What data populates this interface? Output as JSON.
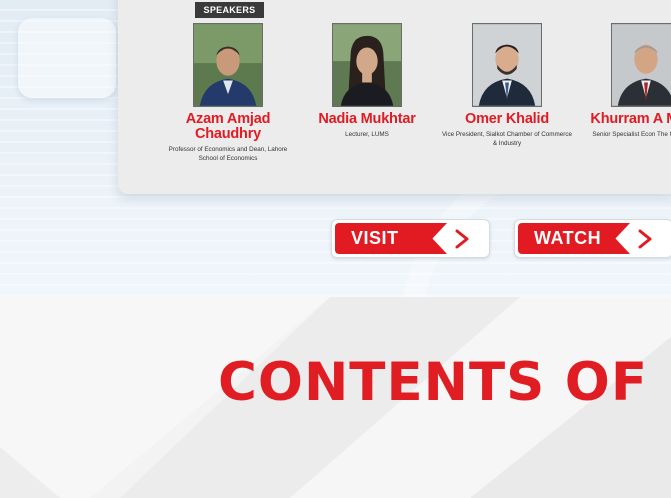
{
  "speakers_label": "SPEAKERS",
  "speakers": [
    {
      "name": "Azam Amjad Chaudhry",
      "title": "Professor of Economics and Dean, Lahore School of Economics"
    },
    {
      "name": "Nadia Mukhtar",
      "title": "Lecturer, LUMS"
    },
    {
      "name": "Omer Khalid",
      "title": "Vice President, Sialkot Chamber of Commerce & Industry"
    },
    {
      "name": "Khurram A Malik",
      "title": "Senior Specialist Econ The Urban Unit"
    }
  ],
  "buttons": {
    "visit_label": "VISIT",
    "watch_label": "WATCH"
  },
  "section_heading": "CONTENTS OF",
  "colors": {
    "accent": "#e21b23",
    "tag_bg": "#3a3a3a",
    "card_bg": "#ececec"
  },
  "icons": {
    "button_arrow": "chevron-right-icon"
  }
}
